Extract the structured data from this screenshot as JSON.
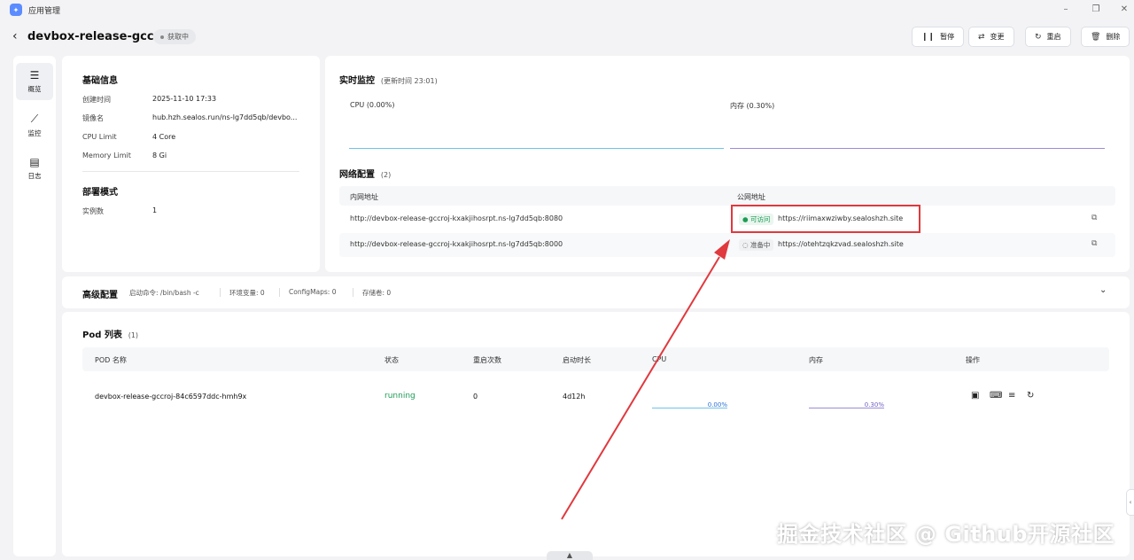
{
  "window": {
    "app_title": "应用管理",
    "minimize_icon": "minimize-icon",
    "restore_icon": "restore-icon"
  },
  "header": {
    "title": "devbox-release-gccroj",
    "status_badge": "获取中",
    "actions": [
      {
        "label": "暂停",
        "icon": "pause-icon"
      },
      {
        "label": "变更",
        "icon": "swap-icon"
      },
      {
        "label": "重启",
        "icon": "restart-icon"
      },
      {
        "label": "删除",
        "icon": "trash-icon"
      }
    ]
  },
  "sidebar": {
    "items": [
      {
        "label": "概览",
        "icon": "server-icon",
        "active": true
      },
      {
        "label": "监控",
        "icon": "chart-icon",
        "active": false
      },
      {
        "label": "日志",
        "icon": "calendar-log-icon",
        "active": false
      }
    ]
  },
  "basic_info": {
    "title": "基础信息",
    "rows": [
      {
        "key": "创建时间",
        "value": "2025-11-10 17:33"
      },
      {
        "key": "镜像名",
        "value": "hub.hzh.sealos.run/ns-lg7dd5qb/devbo..."
      },
      {
        "key": "CPU Limit",
        "value": "4 Core"
      },
      {
        "key": "Memory Limit",
        "value": "8 Gi"
      }
    ],
    "deploy_title": "部署模式",
    "deploy_rows": [
      {
        "key": "实例数",
        "value": "1"
      }
    ]
  },
  "monitor": {
    "title": "实时监控",
    "updated": "(更新时间 23:01)",
    "cpu_label": "CPU",
    "cpu_value": "(0.00%)",
    "mem_label": "内存",
    "mem_value": "(0.30%)",
    "cpu_color": "#6fc3e8",
    "mem_color": "#9c8cd6"
  },
  "network": {
    "title": "网络配置",
    "count": "(2)",
    "col_internal": "内网地址",
    "col_public": "公网地址",
    "rows": [
      {
        "internal": "http://devbox-release-gccroj-kxakjihosrpt.ns-lg7dd5qb:8080",
        "status": "可访问",
        "public": "https://riimaxwziwby.sealoshzh.site"
      },
      {
        "internal": "http://devbox-release-gccroj-kxakjihosrpt.ns-lg7dd5qb:8000",
        "status": "准备中",
        "public": "https://otehtzqkzvad.sealoshzh.site"
      }
    ]
  },
  "advanced": {
    "title": "高级配置",
    "start_cmd": "启动命令: /bin/bash -c",
    "env": "环境变量: 0",
    "configmaps": "ConfigMaps: 0",
    "storage": "存储卷: 0"
  },
  "pods": {
    "title": "Pod 列表",
    "count": "(1)",
    "columns": [
      "POD 名称",
      "状态",
      "重启次数",
      "启动时长",
      "CPU",
      "内存",
      "操作"
    ],
    "rows": [
      {
        "name": "devbox-release-gccroj-84c6597ddc-hmh9x",
        "status": "running",
        "restarts": "0",
        "uptime": "4d12h",
        "cpu": "0.00%",
        "mem": "0.30%"
      }
    ],
    "op_icons": [
      "log-icon",
      "terminal-icon",
      "detail-icon",
      "restart-icon"
    ]
  },
  "watermark": "掘金技术社区 @ Github开源社区"
}
